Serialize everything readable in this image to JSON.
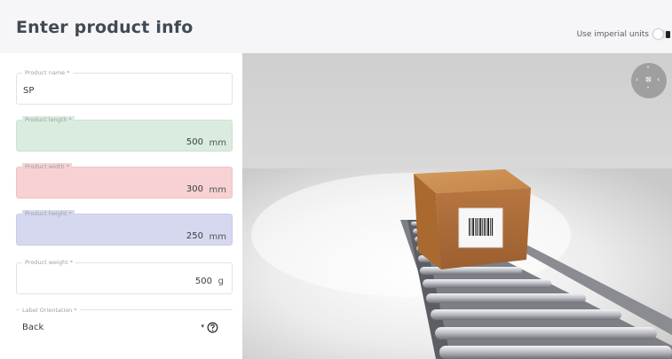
{
  "header": {
    "title": "Enter product info",
    "imperial_label": "Use imperial units",
    "imperial_enabled": false
  },
  "form": {
    "name": {
      "label": "Product name *",
      "value": "SP"
    },
    "length": {
      "label": "Product length *",
      "value": "500",
      "unit": "mm",
      "color": "#d9ecdf"
    },
    "width": {
      "label": "Product width *",
      "value": "300",
      "unit": "mm",
      "color": "#f7d1d3"
    },
    "height": {
      "label": "Product height *",
      "value": "250",
      "unit": "mm",
      "color": "#d6d8ef"
    },
    "weight": {
      "label": "Product weight *",
      "value": "500",
      "unit": "g"
    },
    "label_orientation": {
      "label": "Label Orientation *",
      "value": "Back",
      "caret": "▾"
    }
  },
  "viewer": {
    "nav_icon": "view-orientation-icon",
    "nav_glyphs": {
      "up": "˅",
      "left": "›",
      "center": "⊠",
      "right": "‹",
      "down": "˄"
    }
  }
}
